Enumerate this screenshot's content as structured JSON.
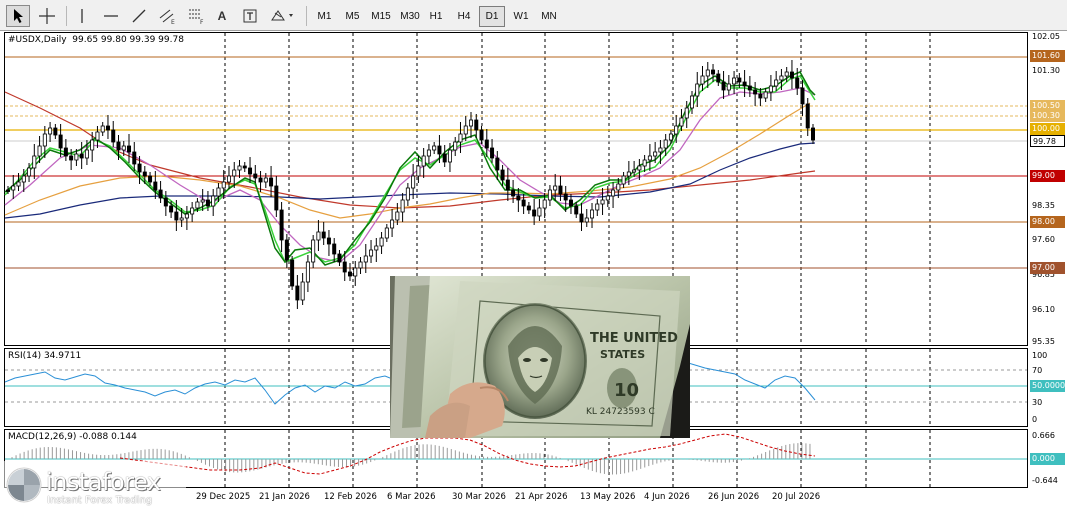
{
  "toolbar": {
    "cursor_icon": "arrow-cursor-icon",
    "tools": [
      "crosshair-icon",
      "vertical-line-icon",
      "horizontal-line-icon",
      "trendline-icon",
      "equidistant-channel-icon",
      "fibonacci-icon",
      "text-icon",
      "text-label-icon",
      "shapes-dropdown-icon"
    ],
    "text_tool_label": "A",
    "timeframes": [
      "M1",
      "M5",
      "M15",
      "M30",
      "H1",
      "H4",
      "D1",
      "W1",
      "MN"
    ],
    "active_timeframe": "D1"
  },
  "main_chart": {
    "title": "#USDX,Daily  99.65 99.80 99.39 99.78",
    "price_scale": [
      "102.05",
      "101.30",
      "100.00",
      "99.00",
      "98.35",
      "97.60",
      "96.85",
      "96.10",
      "95.35"
    ],
    "level_tags": [
      {
        "label": "101.60",
        "color": "#b5651d"
      },
      {
        "label": "100.50",
        "color": "#e6b85c"
      },
      {
        "label": "100.30",
        "color": "#e6b85c"
      },
      {
        "label": "100.00",
        "color": "#e6b000"
      },
      {
        "label": "99.78",
        "color": "#ffffff"
      },
      {
        "label": "99.00",
        "color": "#c00000"
      },
      {
        "label": "98.00",
        "color": "#b5651d"
      },
      {
        "label": "97.00",
        "color": "#a0522d"
      }
    ]
  },
  "rsi": {
    "title": "RSI(14) 34.9711",
    "scale": [
      "100",
      "70",
      "50.0000",
      "30",
      "0"
    ],
    "level_tag_color": "#3fbfbf"
  },
  "macd": {
    "title": "MACD(12,26,9) -0.088 0.144",
    "scale": [
      "0.666",
      "0.000",
      "-0.644"
    ],
    "zero_tag_color": "#3fbfbf"
  },
  "time_axis": [
    "29 Dec 2025",
    "21 Jan 2026",
    "12 Feb 2026",
    "6 Mar 2026",
    "30 Mar 2026",
    "21 Apr 2026",
    "13 May 2026",
    "4 Jun 2026",
    "26 Jun 2026",
    "20 Jul 2026"
  ],
  "logo": {
    "brand": "instaforex",
    "tagline": "Instant Forex Trading",
    "icon": "instaforex-logo-icon"
  },
  "photo": {
    "subject": "us-dollar-banknotes-photo",
    "note_serial": "KL 24723593 C"
  },
  "colors": {
    "candles": "#000000",
    "ma_green_dark": "#0a7a0a",
    "ma_green_light": "#3ad23a",
    "ma_purple": "#c066c0",
    "ma_orange": "#e6a040",
    "ma_navy": "#1a2a7a",
    "ma_brown": "#c0392b",
    "rsi_line": "#2a8fd6",
    "macd_hist": "#999999",
    "macd_signal": "#cc0000"
  }
}
